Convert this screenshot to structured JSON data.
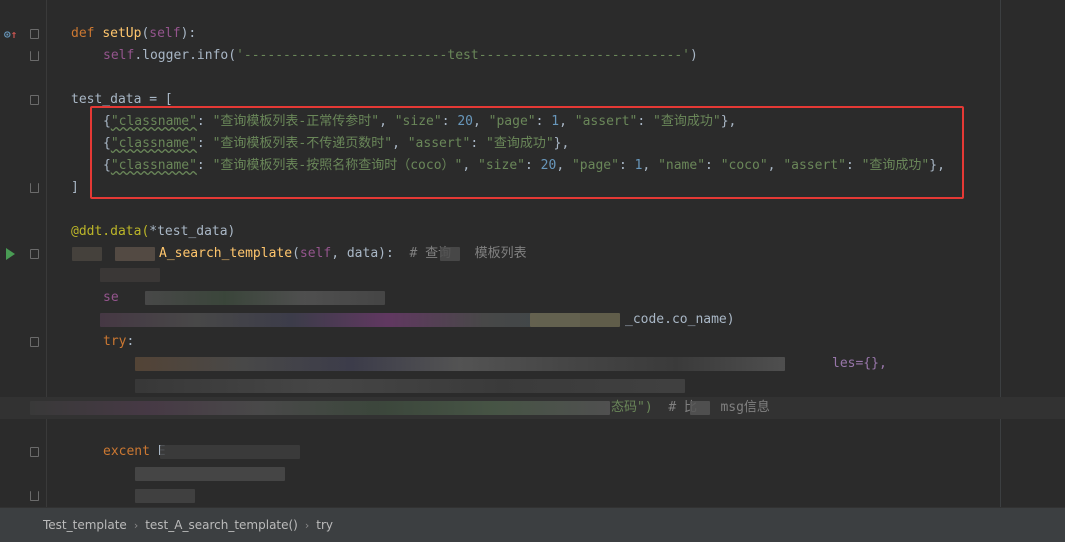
{
  "editor": {
    "lines": {
      "setup_def": {
        "kw": "def ",
        "name": "setUp",
        "open": "(",
        "self": "self",
        "close": "):"
      },
      "logger": {
        "self": "self",
        "mid": ".logger.info(",
        "str": "'--------------------------test--------------------------'",
        "close": ")"
      },
      "test_data": {
        "text": "test_data = ["
      },
      "row1": {
        "a": "{",
        "k1": "\"classname\"",
        "b": ": ",
        "v1": "\"查询模板列表-正常传参时\"",
        "c": ", ",
        "k2": "\"size\"",
        "d": ": ",
        "n1": "20",
        "e": ", ",
        "k3": "\"page\"",
        "f": ": ",
        "n2": "1",
        "g": ", ",
        "k4": "\"assert\"",
        "h": ": ",
        "v2": "\"查询成功\"",
        "i": "},"
      },
      "row2": {
        "a": "{",
        "k1": "\"classname\"",
        "b": ": ",
        "v1": "\"查询模板列表-不传递页数时\"",
        "c": ", ",
        "k2": "\"assert\"",
        "d": ": ",
        "v2": "\"查询成功\"",
        "e": "},"
      },
      "row3": {
        "a": "{",
        "k1": "\"classname\"",
        "b": ": ",
        "v1": "\"查询模板列表-按照名称查询时（coco）\"",
        "c": ", ",
        "k2": "\"size\"",
        "d": ": ",
        "n1": "20",
        "e": ", ",
        "k3": "\"page\"",
        "f": ": ",
        "n2": "1",
        "g": ", ",
        "k4": "\"name\"",
        "h": ": ",
        "v2": "\"coco\"",
        "i": ", ",
        "k5": "\"assert\"",
        "j": ": ",
        "v3": "\"查询成功\"",
        "k": "},"
      },
      "close_bracket": {
        "text": "]"
      },
      "decorator": {
        "at": "@ddt.data(",
        "rest": "*test_data)"
      },
      "search_def": {
        "name": "A_search_template",
        "open": "(",
        "self": "self",
        "mid": ", data):  ",
        "comment": "# 查询   模板列表"
      },
      "se": {
        "text": "se"
      },
      "co_name": {
        "text": "_code.co_name)"
      },
      "try": {
        "kw": "try",
        "colon": ":"
      },
      "les": {
        "text": "les={},"
      },
      "msg": {
        "str": "态码\")",
        "comment": "# 比   msg信息"
      },
      "except": {
        "kw": "excent",
        "rest": " E"
      }
    }
  },
  "breadcrumb": {
    "items": [
      "Test_template",
      "test_A_search_template()",
      "try"
    ]
  }
}
